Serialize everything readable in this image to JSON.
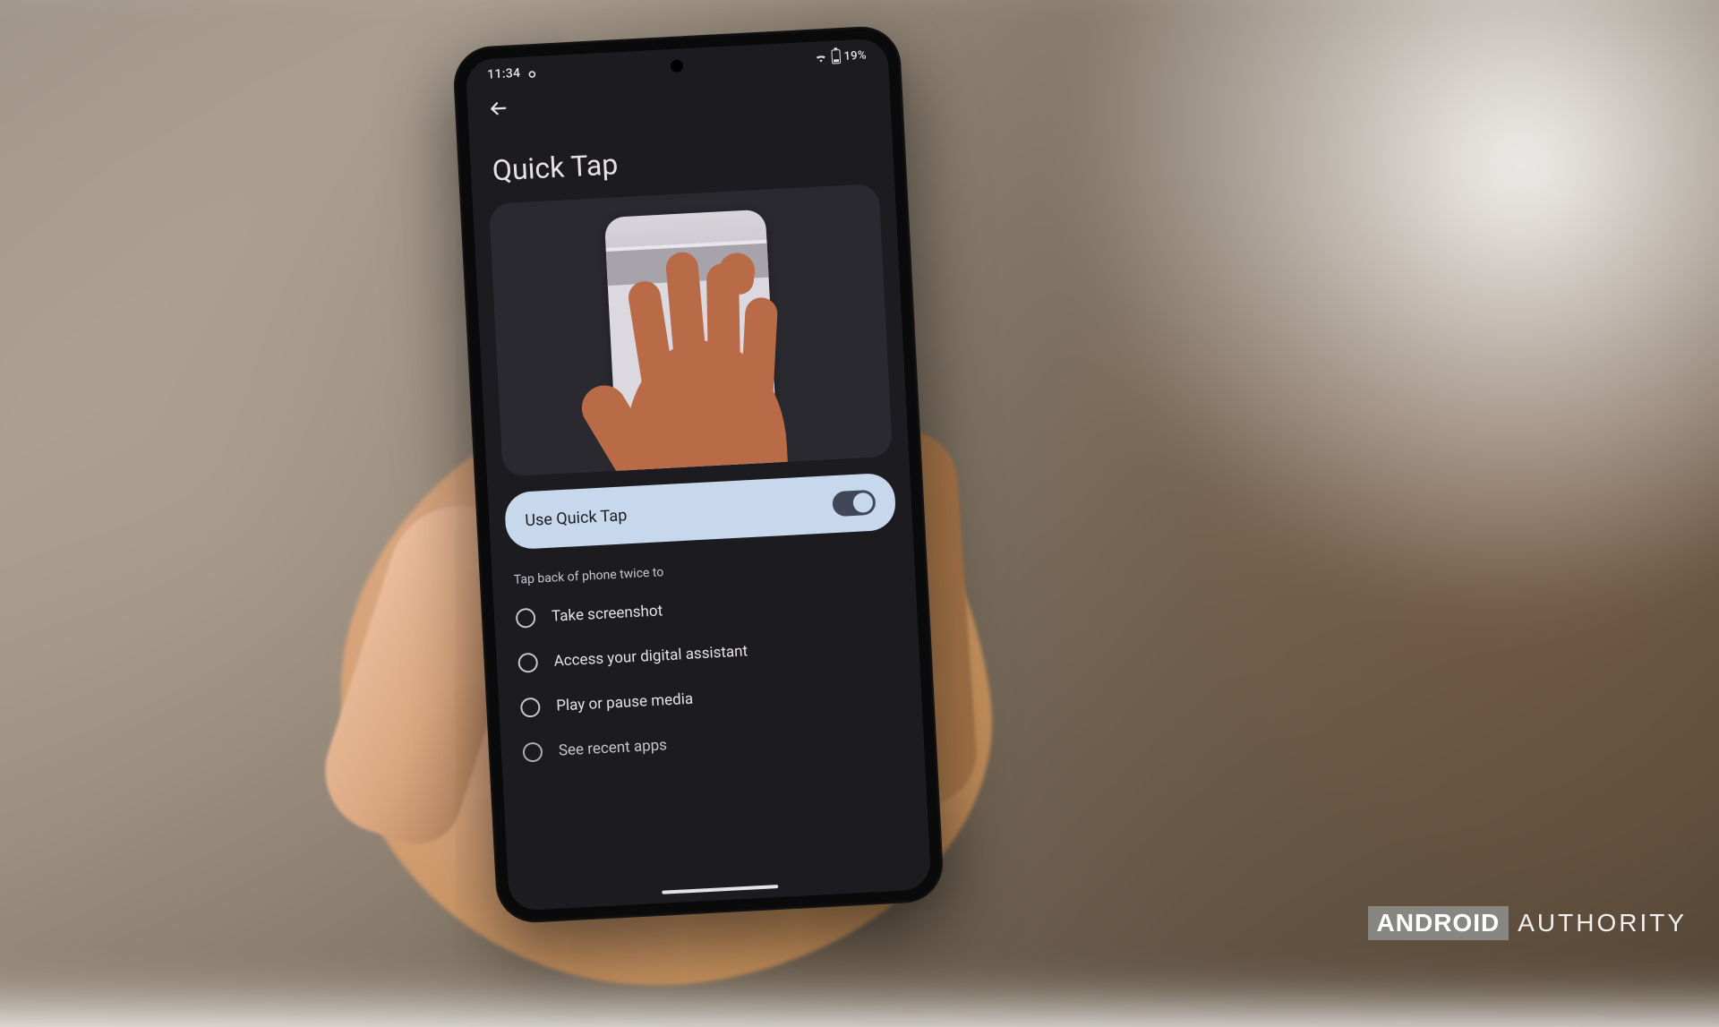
{
  "status_bar": {
    "time": "11:34",
    "battery_text": "19%"
  },
  "nav": {
    "back_aria": "Back"
  },
  "page": {
    "title": "Quick Tap"
  },
  "toggle": {
    "label": "Use Quick Tap",
    "enabled": true
  },
  "section_header": "Tap back of phone twice to",
  "options": [
    {
      "label": "Take screenshot"
    },
    {
      "label": "Access your digital assistant"
    },
    {
      "label": "Play or pause media"
    },
    {
      "label": "See recent apps"
    }
  ],
  "watermark": {
    "boxed": "ANDROID",
    "rest": "AUTHORITY"
  }
}
